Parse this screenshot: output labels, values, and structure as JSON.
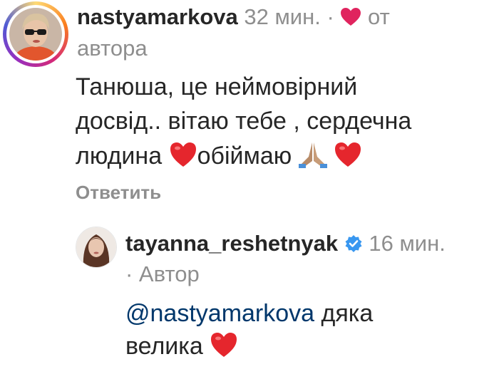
{
  "comment1": {
    "username": "nastyamarkova",
    "time": "32 мин.",
    "separator": "·",
    "liked_by_prefix": "от",
    "liked_by_suffix": "автора",
    "text_line1": "Танюша, це неймовірний",
    "text_line2": "досвід.. вітаю тебе , сердечна",
    "text_line3_a": "людина",
    "text_line3_b": "обіймаю",
    "reply_label": "Ответить"
  },
  "comment2": {
    "username": "tayanna_reshetnyak",
    "time": "16 мин.",
    "author_label": "· Автор",
    "mention": "@nastyamarkova",
    "text_rest": "дяка",
    "text_line2": "велика"
  },
  "colors": {
    "heart": "#e0245e",
    "verified": "#3897f0",
    "mention": "#00376b",
    "muted": "#8e8e8e"
  }
}
